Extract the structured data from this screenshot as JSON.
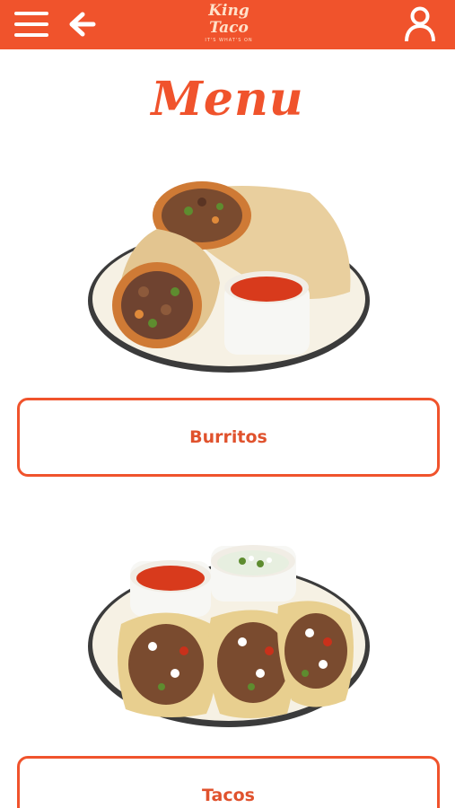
{
  "header": {
    "logo_line1": "King",
    "logo_line2": "Taco",
    "logo_tagline": "IT'S WHAT'S ON",
    "menu_icon": "hamburger-menu-icon",
    "back_icon": "arrow-left-icon",
    "account_icon": "user-icon"
  },
  "page": {
    "title": "Menu"
  },
  "categories": [
    {
      "label": "Burritos",
      "image": "burrito-plate-image"
    },
    {
      "label": "Tacos",
      "image": "tacos-plate-image"
    }
  ],
  "colors": {
    "brand": "#f0532c",
    "logo_text": "#ffe1c9",
    "background": "#ffffff"
  }
}
